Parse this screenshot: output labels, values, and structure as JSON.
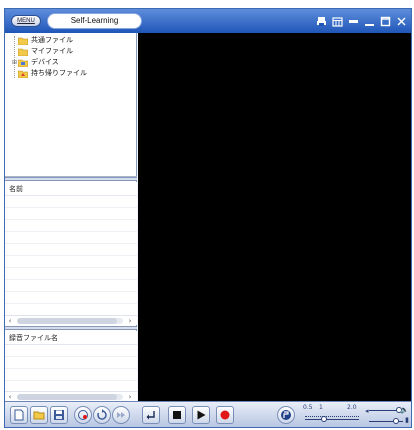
{
  "window": {
    "menu_label": "MENU",
    "title": "Self-Learning",
    "controls": [
      "print-icon",
      "calendar-icon",
      "restore-icon",
      "minimize-icon",
      "maximize-icon",
      "close-icon"
    ]
  },
  "tree": {
    "items": [
      {
        "label": "共通ファイル",
        "expandable": false,
        "icon": "folder-icon"
      },
      {
        "label": "マイファイル",
        "expandable": false,
        "icon": "folder-icon"
      },
      {
        "label": "デバイス",
        "expandable": true,
        "icon": "device-folder-icon"
      },
      {
        "label": "持ち帰りファイル",
        "expandable": false,
        "icon": "takeout-folder-icon"
      }
    ]
  },
  "file_list": {
    "header": "名前",
    "rows": 10
  },
  "recording_list": {
    "header": "録音ファイル名",
    "rows": 3
  },
  "toolbar": {
    "speed_min": "0.5",
    "speed_mid": "1",
    "speed_max": "2.0",
    "speed_value": 1.0,
    "volume_level": 0.9,
    "balance_level": 0.8
  }
}
